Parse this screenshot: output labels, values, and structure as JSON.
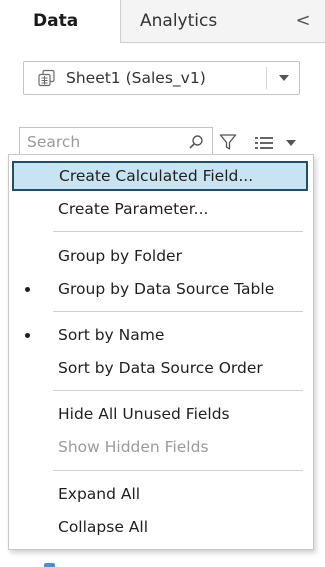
{
  "tabs": {
    "data_label": "Data",
    "analytics_label": "Analytics",
    "collapse_glyph": "<"
  },
  "data_source": {
    "selected": "Sheet1 (Sales_v1)",
    "icon": "linked-sheet-icon"
  },
  "search": {
    "placeholder": "Search",
    "value": ""
  },
  "toolbar_icons": [
    "search-icon",
    "filter-icon",
    "view-list-icon",
    "chevron-down-icon"
  ],
  "menu": {
    "items": [
      {
        "label": "Create Calculated Field...",
        "highlighted": true,
        "enabled": true,
        "checked": false
      },
      {
        "label": "Create Parameter...",
        "enabled": true,
        "checked": false
      },
      {
        "label": "Group by Folder",
        "enabled": true,
        "checked": false
      },
      {
        "label": "Group by Data Source Table",
        "enabled": true,
        "checked": true
      },
      {
        "label": "Sort by Name",
        "enabled": true,
        "checked": true
      },
      {
        "label": "Sort by Data Source Order",
        "enabled": true,
        "checked": false
      },
      {
        "label": "Hide All Unused Fields",
        "enabled": true,
        "checked": false
      },
      {
        "label": "Show Hidden Fields",
        "enabled": false,
        "checked": false
      },
      {
        "label": "Expand All",
        "enabled": true,
        "checked": false
      },
      {
        "label": "Collapse All",
        "enabled": true,
        "checked": false
      }
    ]
  },
  "colors": {
    "highlight_bg": "#c8e3f1",
    "highlight_border": "#1f4e66",
    "disabled_text": "#9b9b9b"
  }
}
